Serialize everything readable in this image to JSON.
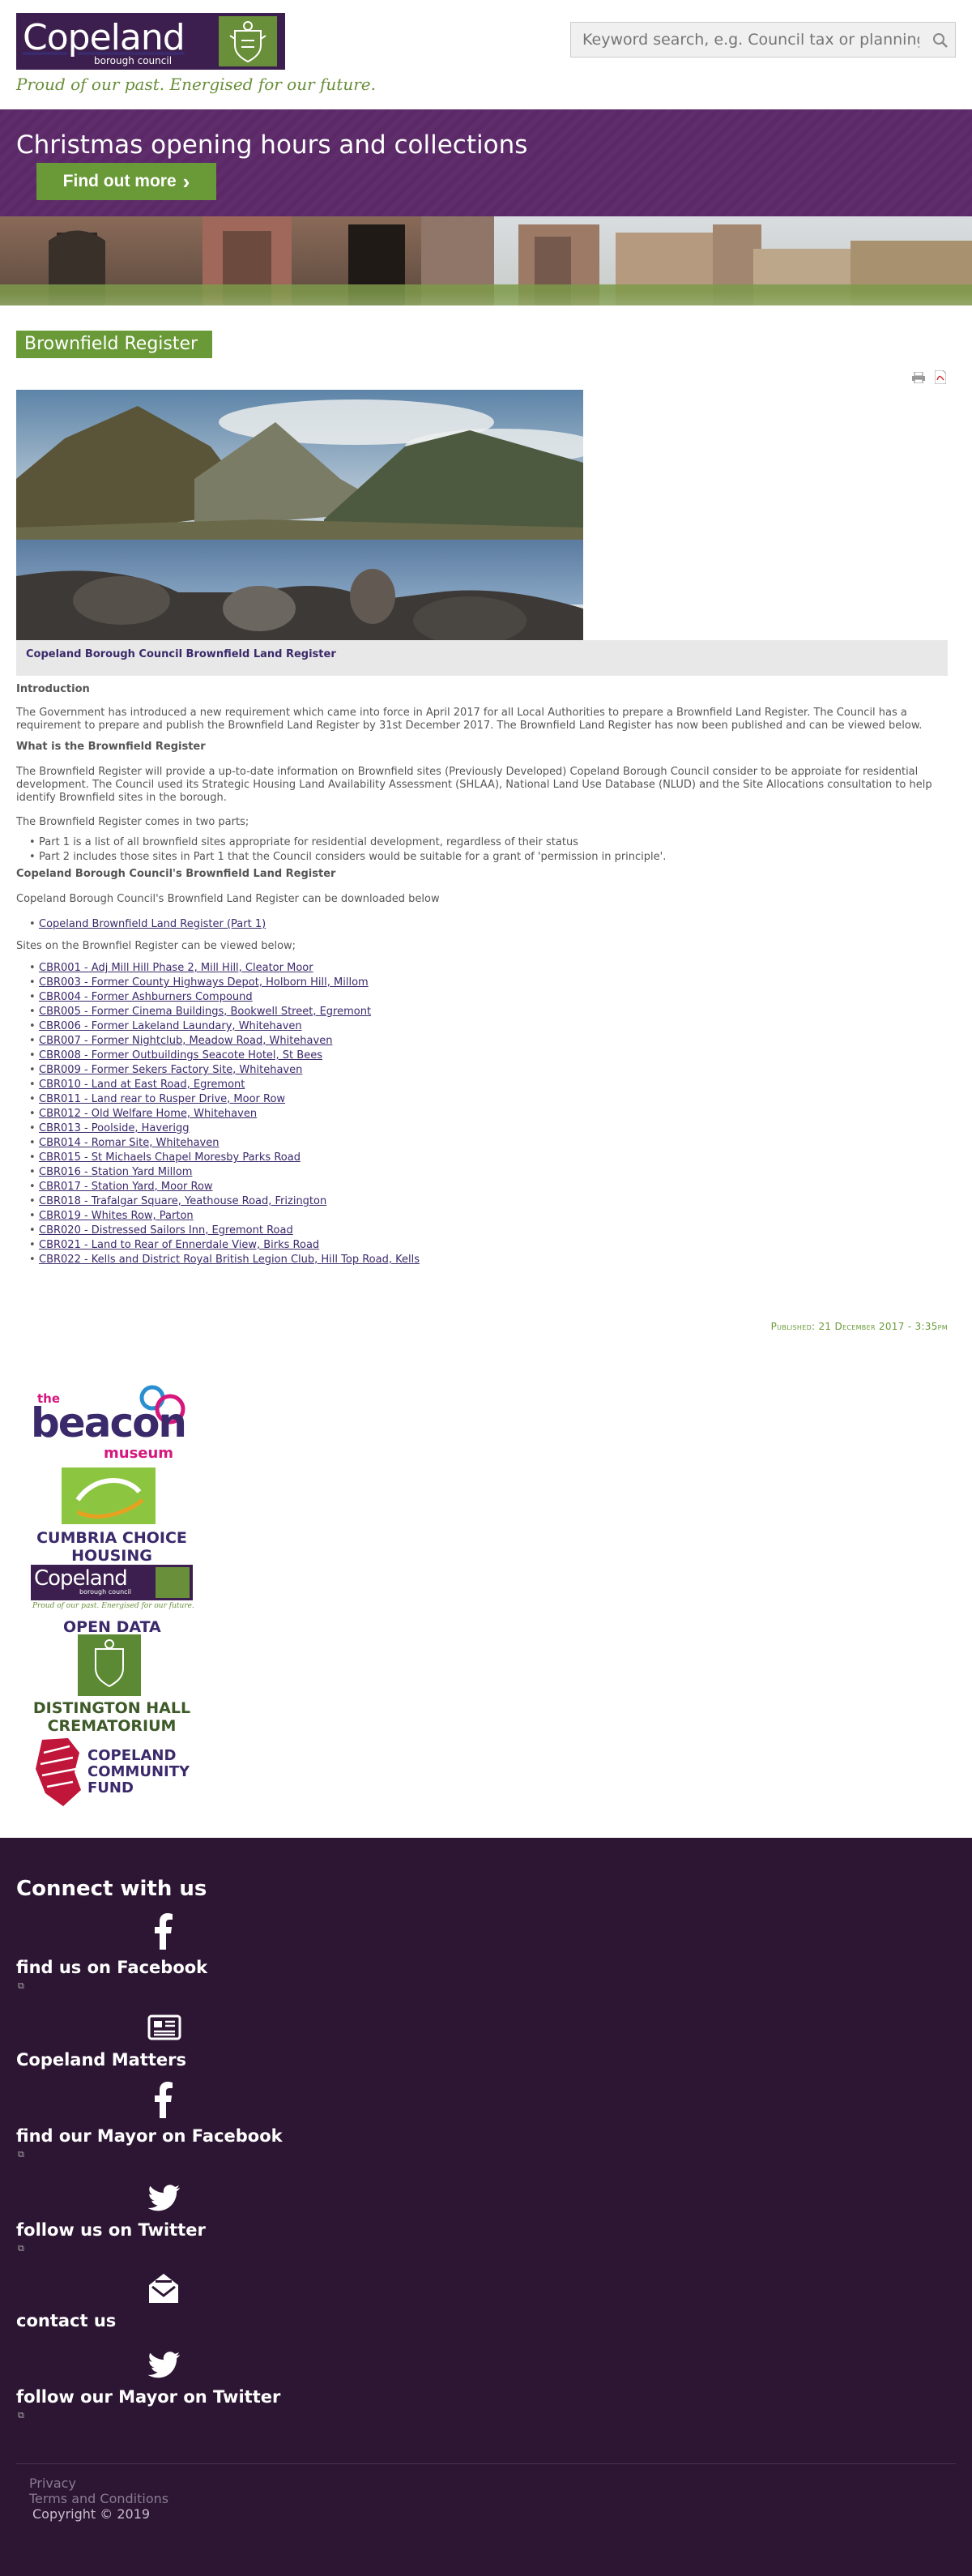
{
  "header": {
    "logo_name": "Copeland",
    "logo_sub": "borough council",
    "tagline": "Proud of our past. Energised for our future.",
    "search_placeholder": "Keyword search, e.g. Council tax or planning"
  },
  "banner": {
    "title": "Christmas opening hours and collections",
    "button_label": "Find out more",
    "button_glyph": "›"
  },
  "page": {
    "title": "Brownfield Register",
    "caption": "Copeland Borough Council Brownfield Land Register",
    "intro_heading": "Introduction",
    "intro_text": "The Government has introduced a new requirement which came into force in April 2017 for all Local Authorities to prepare a Brownfield Land Register.  The Council has a requirement to prepare and publish the Brownfield Land Register by 31st December 2017.  The Brownfield Land Register has now been published and can be viewed below.",
    "what_heading": "What is the Brownfield Register",
    "what_text": "The Brownfield Register will provide a up-to-date information on Brownfield sites (Previously Developed) Copeland Borough Council consider to be approiate for residential development.  The Council used its Strategic Housing Land Availability Assessment (SHLAA), National Land Use Database (NLUD) and the Site Allocations consultation to help identify Brownfield sites in the borough.",
    "parts_intro": "The Brownfield Register comes in two parts;",
    "parts": [
      "Part 1 is a list of all brownfield sites appropriate for residential development, regardless of their status",
      "Part 2 includes those sites in Part 1 that the Council considers would be suitable for a grant of 'permission in principle'."
    ],
    "register_heading": "Copeland Borough Council's Brownfield Land Register",
    "register_text": "Copeland Borough Council's Brownfield Land Register can be downloaded below",
    "download_link": "Copeland Brownfield Land Register (Part 1)",
    "sites_intro": "Sites on the Brownfiel Register can be viewed below;",
    "sites": [
      "CBR001 - Adj Mill Hill Phase 2, Mill Hill, Cleator Moor",
      "CBR003 - Former County Highways Depot, Holborn Hill, Millom",
      "CBR004 - Former Ashburners Compound",
      "CBR005 - Former Cinema Buildings, Bookwell Street, Egremont",
      "CBR006 - Former Lakeland Laundary, Whitehaven",
      "CBR007 - Former Nightclub, Meadow Road, Whitehaven",
      "CBR008 - Former Outbuildings Seacote Hotel, St Bees",
      "CBR009 - Former Sekers Factory Site, Whitehaven",
      "CBR010 - Land at East Road, Egremont",
      "CBR011 - Land rear to Rusper Drive, Moor Row",
      "CBR012 - Old Welfare Home, Whitehaven",
      "CBR013 - Poolside, Haverigg",
      "CBR014 - Romar Site, Whitehaven",
      "CBR015 - St Michaels Chapel Moresby Parks Road",
      "CBR016 - Station Yard Millom",
      "CBR017 - Station Yard, Moor Row",
      "CBR018 - Trafalgar Square, Yeathouse Road, Frizington",
      "CBR019 - Whites Row, Parton",
      "CBR020 - Distressed Sailors Inn, Egremont Road",
      "CBR021 - Land to Rear of Ennerdale View, Birks Road",
      "CBR022 - Kells and District Royal British Legion Club, Hill Top Road, Kells"
    ],
    "published": "Published: 21 December 2017 - 3:35pm"
  },
  "partners": {
    "beacon_the": "the",
    "beacon_name": "beacon",
    "beacon_sub": "museum",
    "cumbria": "CUMBRIA CHOICE HOUSING",
    "copeland_name": "Copeland",
    "copeland_sub": "borough council",
    "copeland_tag": "Proud of our past. Energised for our future.",
    "open_data": "OPEN DATA",
    "distington": "DISTINGTON HALL CREMATORIUM",
    "community_1": "COPELAND",
    "community_2": "COMMUNITY",
    "community_3": "FUND"
  },
  "footer": {
    "connect": "Connect with us",
    "social": [
      {
        "label": "find us on Facebook",
        "icon": "facebook-icon",
        "ext": "⧉"
      },
      {
        "label": "Copeland Matters",
        "icon": "newspaper-icon",
        "ext": ""
      },
      {
        "label": "find our Mayor on Facebook",
        "icon": "facebook-icon",
        "ext": "⧉"
      },
      {
        "label": "follow us on Twitter",
        "icon": "twitter-icon",
        "ext": "⧉"
      },
      {
        "label": "contact us",
        "icon": "envelope-icon",
        "ext": ""
      },
      {
        "label": "follow our Mayor on Twitter",
        "icon": "twitter-icon",
        "ext": "⧉"
      }
    ],
    "privacy": "Privacy",
    "terms": "Terms and Conditions",
    "copyright": "Copyright © 2019"
  },
  "colors": {
    "brand_purple": "#3c1f4e",
    "banner_purple": "#5f2d6c",
    "accent_green": "#6a9a37",
    "footer_bg": "#2d1633",
    "link": "#3b2a6b"
  }
}
